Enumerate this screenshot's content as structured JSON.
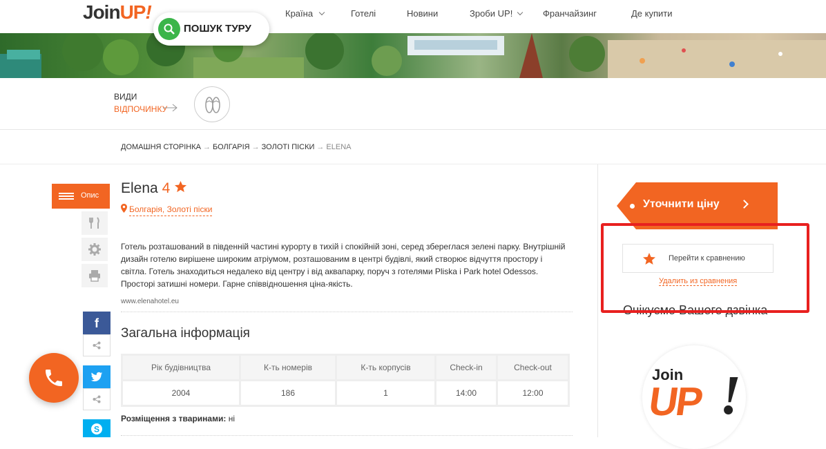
{
  "header": {
    "logo_join": "Join",
    "logo_up": "UP",
    "logo_excl": "!",
    "search_label": "ПОШУК ТУРУ",
    "nav": [
      {
        "label": "Країна",
        "has_dropdown": true
      },
      {
        "label": "Готелі",
        "has_dropdown": false
      },
      {
        "label": "Новини",
        "has_dropdown": false
      },
      {
        "label": "Зроби UP!",
        "has_dropdown": true
      },
      {
        "label": "Франчайзинг",
        "has_dropdown": false
      },
      {
        "label": "Де купити",
        "has_dropdown": false
      }
    ]
  },
  "vacation_types": {
    "line1": "ВИДИ",
    "line2": "ВІДПОЧИНКУ",
    "icon": "flip-flops-icon"
  },
  "breadcrumb": {
    "items": [
      "ДОМАШНЯ СТОРІНКА",
      "БОЛГАРІЯ",
      "ЗОЛОТІ ПІСКИ"
    ],
    "current": "ELENA",
    "separator": "→"
  },
  "side_tabs": {
    "description_label": "Опис",
    "icons": [
      "fork-knife-icon",
      "gear-icon",
      "printer-icon"
    ]
  },
  "social": {
    "facebook": "f",
    "twitter": "twitter-icon",
    "skype": "skype-icon"
  },
  "hotel": {
    "name": "Elena",
    "stars": "4",
    "location": "Болгарія, Золоті піски",
    "description": "Готель розташований в південній частині курорту в тихій і спокійній зоні, серед збереглася зелені парку. Внутрішній дизайн готелю вирішене широким атріумом, розташованим в центрі будівлі, який створює відчуття простору і світла. Готель знаходиться недалеко від центру і від аквапарку, поруч з готелями Pliska і Park hotel Odessos. Просторі затишні номери. Гарне співвідношення ціна-якість.",
    "website": "www.elenahotel.eu"
  },
  "general_info": {
    "title": "Загальна інформація",
    "headers": [
      "Рік будівництва",
      "К-ть номерів",
      "К-ть корпусів",
      "Check-in",
      "Check-out"
    ],
    "row": [
      "2004",
      "186",
      "1",
      "14:00",
      "12:00"
    ],
    "pets_label": "Розміщення з тваринами:",
    "pets_value": "ні"
  },
  "right_panel": {
    "price_button": "Уточнити ціну",
    "compare_button": "Перейти к сравнению",
    "remove_compare": "Удалить из сравнения",
    "waiting_call": "Очікуємо Вашого дзвінка",
    "logo_join": "Join",
    "logo_up": "UP",
    "logo_excl": "!"
  },
  "colors": {
    "accent": "#f26522",
    "search_green": "#3bb54a",
    "facebook": "#3b5998",
    "twitter": "#1da1f2",
    "skype": "#00aff0",
    "highlight_red": "#e8201f"
  }
}
